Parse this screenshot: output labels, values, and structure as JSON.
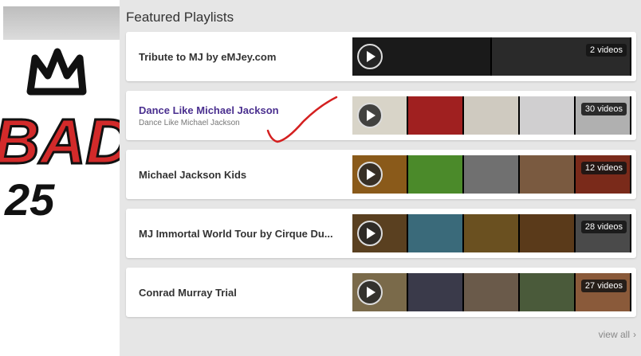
{
  "section_title": "Featured Playlists",
  "artwork_text": {
    "big": "BAD",
    "number": "25"
  },
  "playlists": [
    {
      "title": "Tribute to MJ by eMJey.com",
      "subtitle": "",
      "count_label": "2 videos",
      "thumbs": [
        "#1a1a1a",
        "#2a2a2a"
      ]
    },
    {
      "title": "Dance Like Michael Jackson",
      "subtitle": "Dance Like Michael Jackson",
      "count_label": "30 videos",
      "thumbs": [
        "#d8d4c8",
        "#a02020",
        "#cfcac0",
        "#d0cfd0",
        "#b0b0b0"
      ]
    },
    {
      "title": "Michael Jackson Kids",
      "subtitle": "",
      "count_label": "12 videos",
      "thumbs": [
        "#8a5a1a",
        "#4b8a2a",
        "#707070",
        "#7a5a40",
        "#7a2a1a"
      ]
    },
    {
      "title": "MJ Immortal World Tour by Cirque Du...",
      "subtitle": "",
      "count_label": "28 videos",
      "thumbs": [
        "#5a4020",
        "#3a6a7a",
        "#6a5020",
        "#5a3a1a",
        "#4a4a4a"
      ]
    },
    {
      "title": "Conrad Murray Trial",
      "subtitle": "",
      "count_label": "27 videos",
      "thumbs": [
        "#7a6a4a",
        "#3a3a4a",
        "#6a5a4a",
        "#4a5a3a",
        "#8a5a3a"
      ]
    }
  ],
  "view_all": {
    "label": "view all",
    "chevron": "›"
  },
  "colors": {
    "annotation": "#d42020",
    "active_title": "#4a2f8f"
  }
}
